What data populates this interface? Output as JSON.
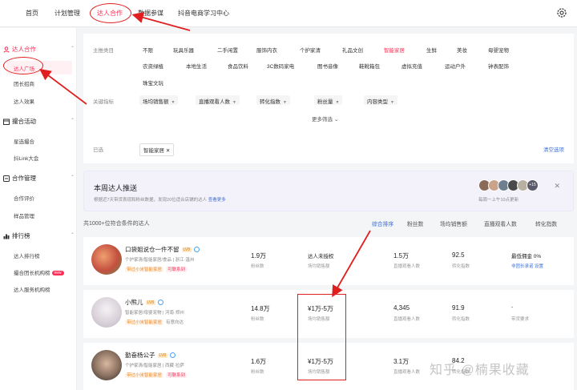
{
  "topnav": {
    "items": [
      "首页",
      "计划管理",
      "达人合作",
      "数据参谋",
      "抖音电商学习中心"
    ],
    "active_index": 2
  },
  "sidebar": {
    "groups": [
      {
        "label": "达人合作",
        "items": [
          "达人广场",
          "团长招商",
          "达人效果"
        ]
      },
      {
        "label": "撮合活动",
        "items": [
          "星选撮合",
          "抖Link大会"
        ]
      },
      {
        "label": "合作管理",
        "items": [
          "合作评价",
          "样品管理"
        ]
      },
      {
        "label": "排行榜",
        "items": [
          "达人排行榜",
          "撮合团长机构榜",
          "达人服务机构榜"
        ],
        "badge": "new"
      }
    ]
  },
  "filter": {
    "category_label": "主推类目",
    "categories_row1": [
      "不限",
      "玩具乐器",
      "二手闲置",
      "服饰内衣",
      "个护家清",
      "礼品文创",
      "智能家居",
      "生鲜",
      "美妆",
      "母婴宠物"
    ],
    "categories_row2": [
      "农资绿植",
      "本地生活",
      "食品饮料",
      "3C数码家电",
      "图书音像",
      "鞋靴箱包",
      "虚拟充值",
      "运动户外",
      "钟表配饰"
    ],
    "categories_row3": [
      "珠宝文玩"
    ],
    "selected_category": "智能家居",
    "metrics_label": "关键指标",
    "metrics": [
      "场均销售额",
      "直播观看人数",
      "转化指数",
      "粉丝量",
      "内容类型"
    ],
    "more_label": "更多筛选",
    "selected_label": "已选",
    "selected_tag": "智能家居",
    "clear_label": "清空选项"
  },
  "recommend": {
    "title": "本周达人推送",
    "desc": "根据近7天带货表现和粉丝数据，发现20位适合店铺的达人",
    "link": "查看更多",
    "plus": "+15",
    "update": "每周一上午10点更新"
  },
  "table": {
    "count": "共1000+位符合条件的达人",
    "headers": [
      "综合排序",
      "粉丝数",
      "场均销售额",
      "直播观看人数",
      "转化指数"
    ],
    "rows": [
      {
        "name": "口袋姐说仓一件不留",
        "level": "LV8",
        "meta": "个护家清/智能家居/食品  |  浙江·温州",
        "tag1": "带过小米智能家居",
        "tag2": "可联系到",
        "fans": "1.9万",
        "fans_label": "粉丝数",
        "sales": "达人未授权",
        "sales_label": "场均销售额",
        "viewers": "1.5万",
        "viewers_label": "直播观看人数",
        "conv": "92.5",
        "conv_label": "转化指数",
        "extra": "最低佣金 0%",
        "extra_label": "非团长承诺  设置"
      },
      {
        "name": "小熊儿",
        "level": "LV8",
        "meta": "智能家居/母婴宠物  |  河南·郑州",
        "tag1": "带过小米智能家居",
        "tag2": "有意向达",
        "fans": "14.8万",
        "fans_label": "粉丝数",
        "sales": "¥1万-5万",
        "sales_label": "场均销售额",
        "viewers": "4,345",
        "viewers_label": "直播观看人数",
        "conv": "91.9",
        "conv_label": "转化指数",
        "extra": "-",
        "extra_label": "带货要求"
      },
      {
        "name": "勤奋杨公子",
        "level": "LV8",
        "meta": "个护家清/智能家居  |  西藏·拉萨",
        "tag1": "带过小米智能家居",
        "tag2": "可联系到",
        "fans": "1.6万",
        "fans_label": "粉丝数",
        "sales": "¥1万-5万",
        "sales_label": "场均销售额",
        "viewers": "3.1万",
        "viewers_label": "直播观看人数",
        "conv": "84.2",
        "conv_label": "转化指数",
        "extra": "",
        "extra_label": ""
      }
    ]
  },
  "watermark": "知乎 @楠果收藏",
  "colors": {
    "accent": "#fe2c55",
    "link": "#3a6fd8",
    "annotation": "#e02020"
  }
}
